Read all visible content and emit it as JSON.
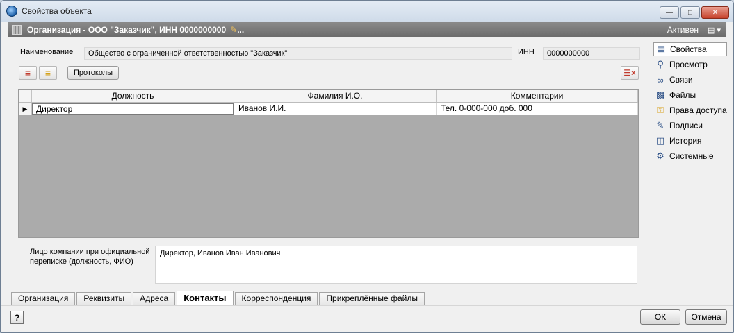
{
  "window": {
    "title": "Свойства объекта"
  },
  "object_bar": {
    "title": "Организация - ООО \"Заказчик\", ИНН 0000000000",
    "ellipsis": "...",
    "status": "Активен"
  },
  "form": {
    "name_label": "Наименование",
    "name_value": "Общество с ограниченной ответственностью \"Заказчик\"",
    "inn_label": "ИНН",
    "inn_value": "0000000000",
    "protocols_button": "Протоколы"
  },
  "grid": {
    "columns": [
      "Должность",
      "Фамилия И.О.",
      "Комментарии"
    ],
    "rows": [
      [
        "Директор",
        "Иванов И.И.",
        "Тел. 0-000-000 доб. 000"
      ]
    ]
  },
  "memo": {
    "label_line1": "Лицо компании при официальной",
    "label_line2": "переписке (должность, ФИО)",
    "value": "Директор, Иванов Иван Иванович"
  },
  "tabs": [
    {
      "label": "Организация",
      "active": false
    },
    {
      "label": "Реквизиты",
      "active": false
    },
    {
      "label": "Адреса",
      "active": false
    },
    {
      "label": "Контакты",
      "active": true
    },
    {
      "label": "Корреспонденция",
      "active": false
    },
    {
      "label": "Прикреплённые файлы",
      "active": false
    }
  ],
  "side_panel": [
    {
      "label": "Свойства",
      "icon": "properties-icon",
      "active": true
    },
    {
      "label": "Просмотр",
      "icon": "magnifier-icon",
      "active": false
    },
    {
      "label": "Связи",
      "icon": "link-icon",
      "active": false
    },
    {
      "label": "Файлы",
      "icon": "files-icon",
      "active": false
    },
    {
      "label": "Права доступа",
      "icon": "key-icon",
      "active": false
    },
    {
      "label": "Подписи",
      "icon": "pen-icon",
      "active": false
    },
    {
      "label": "История",
      "icon": "history-icon",
      "active": false
    },
    {
      "label": "Системные",
      "icon": "system-icon",
      "active": false
    }
  ],
  "footer": {
    "help": "?",
    "ok": "ОК",
    "cancel": "Отмена"
  }
}
